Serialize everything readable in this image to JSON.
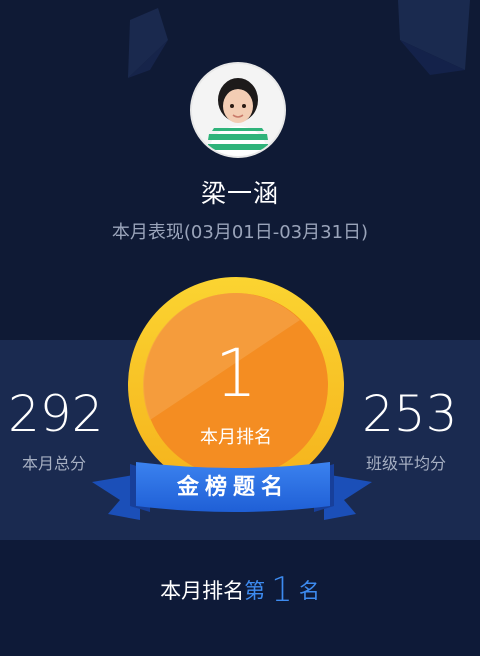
{
  "profile": {
    "name": "梁一涵",
    "period_label": "本月表现(03月01日-03月31日)"
  },
  "stats": {
    "total_score": "292",
    "total_score_label": "本月总分",
    "class_average": "253",
    "class_average_label": "班级平均分"
  },
  "medal": {
    "rank_number": "1",
    "rank_label": "本月排名",
    "ribbon_text": "金榜题名"
  },
  "rank_summary": {
    "prefix": "本月排名",
    "di": "第",
    "number": "1",
    "suffix": "名"
  },
  "colors": {
    "background": "#0f1a36",
    "stats_band": "#1a2a50",
    "medal_gold": "#f7c325",
    "medal_orange": "#f58a1f",
    "ribbon_blue": "#2c6ee0",
    "highlight_blue": "#3d8bf0"
  }
}
